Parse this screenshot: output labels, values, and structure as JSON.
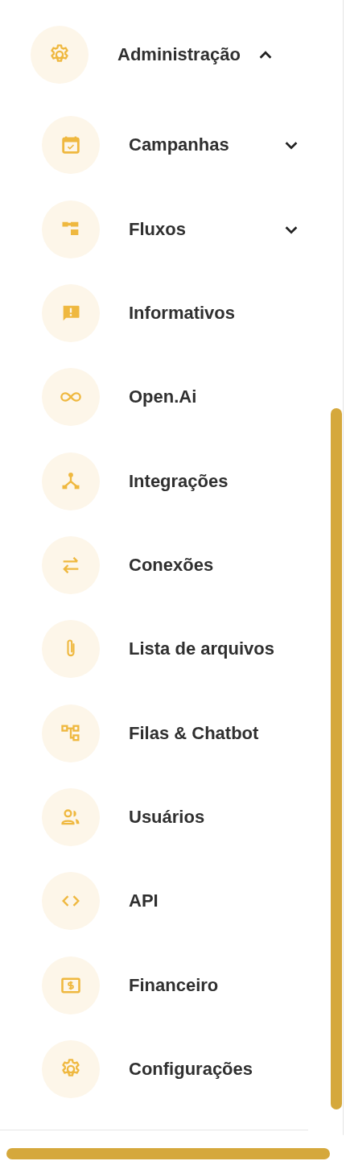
{
  "menu": {
    "label": "Administração",
    "expanded": true,
    "items": [
      {
        "label": "Campanhas",
        "kind": "group",
        "expanded": false
      },
      {
        "label": "Fluxos",
        "kind": "group",
        "expanded": false
      },
      {
        "label": "Informativos",
        "kind": "link"
      },
      {
        "label": "Open.Ai",
        "kind": "link"
      },
      {
        "label": "Integrações",
        "kind": "link"
      },
      {
        "label": "Conexões",
        "kind": "link"
      },
      {
        "label": "Lista de arquivos",
        "kind": "link"
      },
      {
        "label": "Filas & Chatbot",
        "kind": "link"
      },
      {
        "label": "Usuários",
        "kind": "link"
      },
      {
        "label": "API",
        "kind": "link"
      },
      {
        "label": "Financeiro",
        "kind": "link"
      },
      {
        "label": "Configurações",
        "kind": "link"
      }
    ]
  }
}
